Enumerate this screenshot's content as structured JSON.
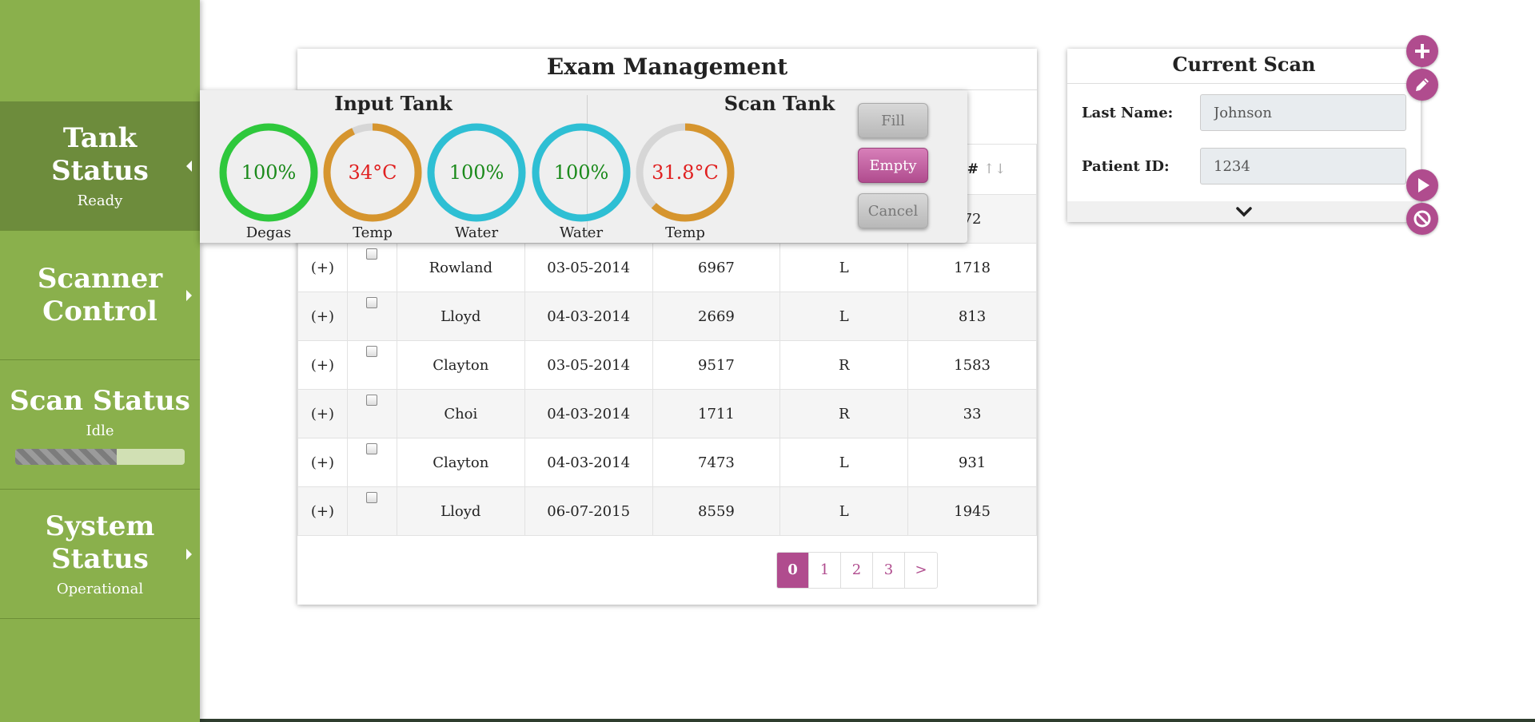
{
  "sidebar": {
    "items": [
      {
        "title": "Tank Status",
        "subtitle": "Ready"
      },
      {
        "title": "Scanner Control"
      },
      {
        "title": "Scan Status",
        "subtitle": "Idle",
        "progress": 0.6
      },
      {
        "title": "System Status",
        "subtitle": "Operational"
      }
    ]
  },
  "exam": {
    "title": "Exam Management",
    "sort_header": "ion #",
    "sort_icon": "↑↓",
    "first_row_partial": "72",
    "rows": [
      {
        "expand": "(+)",
        "name": "Rowland",
        "date": "03-05-2014",
        "id": "6967",
        "side": "L",
        "num": "1718"
      },
      {
        "expand": "(+)",
        "name": "Lloyd",
        "date": "04-03-2014",
        "id": "2669",
        "side": "L",
        "num": "813"
      },
      {
        "expand": "(+)",
        "name": "Clayton",
        "date": "03-05-2014",
        "id": "9517",
        "side": "R",
        "num": "1583"
      },
      {
        "expand": "(+)",
        "name": "Choi",
        "date": "04-03-2014",
        "id": "1711",
        "side": "R",
        "num": "33"
      },
      {
        "expand": "(+)",
        "name": "Clayton",
        "date": "04-03-2014",
        "id": "7473",
        "side": "L",
        "num": "931"
      },
      {
        "expand": "(+)",
        "name": "Lloyd",
        "date": "06-07-2015",
        "id": "8559",
        "side": "L",
        "num": "1945"
      }
    ],
    "pagination": [
      "0",
      "1",
      "2",
      "3",
      ">"
    ]
  },
  "tank": {
    "input_title": "Input Tank",
    "scan_title": "Scan Tank",
    "gauges": [
      {
        "value": "100%",
        "label": "Degas",
        "fraction": 1.0,
        "color": "#2ec83c"
      },
      {
        "value": "34°C",
        "label": "Temp",
        "fraction": 0.93,
        "color": "#d6952e"
      },
      {
        "value": "100%",
        "label": "Water",
        "fraction": 1.0,
        "color": "#2ebfd4"
      },
      {
        "value": "100%",
        "label": "Water",
        "fraction": 1.0,
        "color": "#2ebfd4"
      },
      {
        "value": "31.8°C",
        "label": "Temp",
        "fraction": 0.62,
        "color": "#d6952e"
      }
    ],
    "buttons": {
      "fill": "Fill",
      "empty": "Empty",
      "cancel": "Cancel"
    }
  },
  "scan": {
    "title": "Current Scan",
    "last_name_label": "Last Name:",
    "last_name_value": "Johnson",
    "patient_id_label": "Patient ID:",
    "patient_id_value": "1234"
  },
  "icons": {
    "add": "plus-icon",
    "edit": "pencil-icon",
    "play": "play-icon",
    "cancel": "ban-icon",
    "expand": "chevron-down-icon"
  },
  "colors": {
    "sidebar": "#8ab04c",
    "sidebar_active": "#6d8c3c",
    "accent": "#b04c8e"
  }
}
